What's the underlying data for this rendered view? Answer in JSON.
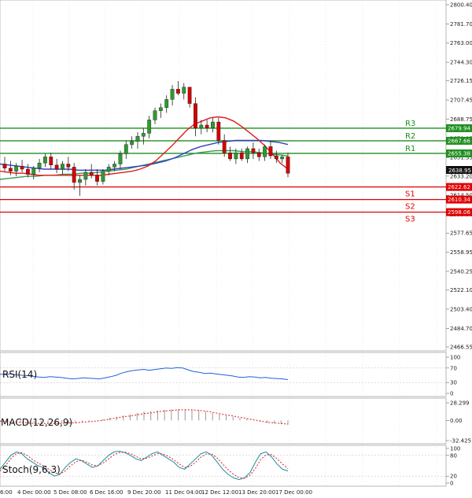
{
  "chart_data": {
    "type": "candlestick",
    "price_axis": {
      "ticks": [
        "2800.40",
        "2781.70",
        "2763.00",
        "2744.30",
        "2726.15",
        "2707.45",
        "2688.75",
        "2670.05",
        "2651.35",
        "2633.20",
        "2614.50",
        "2595.80",
        "2577.65",
        "2558.95",
        "2540.25",
        "2522.10",
        "2503.40",
        "2484.70",
        "2466.55"
      ],
      "ylim": [
        2466.55,
        2800.4
      ]
    },
    "current_price": "2638.95",
    "levels": [
      {
        "name": "R3",
        "value": "2679.94",
        "color": "#1f8f1f"
      },
      {
        "name": "R2",
        "value": "2667.66",
        "color": "#1f8f1f"
      },
      {
        "name": "R1",
        "value": "2655.38",
        "color": "#1f8f1f"
      },
      {
        "name": "S1",
        "value": "2622.62",
        "color": "#e00000"
      },
      {
        "name": "S2",
        "value": "2610.34",
        "color": "#e00000"
      },
      {
        "name": "S3",
        "value": "2598.06",
        "color": "#e00000"
      }
    ],
    "candles_ohlc": [
      [
        2645,
        2652,
        2638,
        2641
      ],
      [
        2641,
        2648,
        2634,
        2638
      ],
      [
        2638,
        2646,
        2633,
        2643
      ],
      [
        2643,
        2649,
        2637,
        2640
      ],
      [
        2640,
        2645,
        2632,
        2635
      ],
      [
        2635,
        2643,
        2630,
        2641
      ],
      [
        2641,
        2650,
        2637,
        2646
      ],
      [
        2646,
        2655,
        2642,
        2652
      ],
      [
        2652,
        2656,
        2640,
        2644
      ],
      [
        2644,
        2650,
        2636,
        2640
      ],
      [
        2640,
        2648,
        2635,
        2645
      ],
      [
        2645,
        2652,
        2638,
        2642
      ],
      [
        2642,
        2646,
        2620,
        2627
      ],
      [
        2627,
        2634,
        2614,
        2630
      ],
      [
        2630,
        2640,
        2624,
        2637
      ],
      [
        2637,
        2645,
        2631,
        2634
      ],
      [
        2634,
        2640,
        2624,
        2628
      ],
      [
        2628,
        2640,
        2625,
        2638
      ],
      [
        2638,
        2645,
        2634,
        2642
      ],
      [
        2642,
        2648,
        2638,
        2645
      ],
      [
        2645,
        2658,
        2640,
        2655
      ],
      [
        2655,
        2668,
        2650,
        2664
      ],
      [
        2664,
        2672,
        2660,
        2667
      ],
      [
        2667,
        2676,
        2660,
        2672
      ],
      [
        2672,
        2680,
        2664,
        2675
      ],
      [
        2675,
        2692,
        2670,
        2688
      ],
      [
        2688,
        2700,
        2684,
        2697
      ],
      [
        2697,
        2704,
        2690,
        2700
      ],
      [
        2700,
        2712,
        2695,
        2708
      ],
      [
        2708,
        2722,
        2702,
        2718
      ],
      [
        2718,
        2726,
        2712,
        2714
      ],
      [
        2714,
        2724,
        2708,
        2720
      ],
      [
        2720,
        2716,
        2700,
        2704
      ],
      [
        2704,
        2710,
        2672,
        2680
      ],
      [
        2680,
        2688,
        2674,
        2683
      ],
      [
        2683,
        2688,
        2676,
        2680
      ],
      [
        2680,
        2690,
        2676,
        2686
      ],
      [
        2686,
        2690,
        2664,
        2668
      ],
      [
        2668,
        2674,
        2652,
        2656
      ],
      [
        2656,
        2662,
        2648,
        2650
      ],
      [
        2650,
        2660,
        2645,
        2656
      ],
      [
        2656,
        2660,
        2648,
        2650
      ],
      [
        2650,
        2662,
        2646,
        2660
      ],
      [
        2660,
        2666,
        2650,
        2656
      ],
      [
        2656,
        2660,
        2648,
        2652
      ],
      [
        2652,
        2664,
        2648,
        2662
      ],
      [
        2662,
        2668,
        2650,
        2653
      ],
      [
        2653,
        2658,
        2646,
        2650
      ],
      [
        2650,
        2654,
        2646,
        2652
      ],
      [
        2652,
        2656,
        2632,
        2636
      ]
    ],
    "ema_red": [
      2638,
      2637,
      2636,
      2636,
      2635,
      2634,
      2634,
      2634,
      2634,
      2634,
      2634,
      2634,
      2634,
      2634,
      2635,
      2636,
      2637,
      2638,
      2640,
      2643,
      2648,
      2655,
      2662,
      2670,
      2678,
      2684,
      2687,
      2690,
      2691,
      2690,
      2687,
      2682,
      2676,
      2670,
      2663,
      2655,
      2646,
      2640
    ],
    "ema_blue": [
      2645,
      2644,
      2643,
      2642,
      2641,
      2640,
      2640,
      2640,
      2640,
      2639,
      2639,
      2639,
      2639,
      2640,
      2641,
      2642,
      2643,
      2644,
      2646,
      2648,
      2651,
      2655,
      2659,
      2662,
      2664,
      2666,
      2667,
      2668,
      2668,
      2668,
      2668,
      2667,
      2666,
      2664
    ],
    "ema_green": [
      2630,
      2631,
      2632,
      2633,
      2633,
      2634,
      2634,
      2635,
      2635,
      2636,
      2636,
      2637,
      2638,
      2639,
      2640,
      2642,
      2644,
      2646,
      2648,
      2650,
      2652,
      2654,
      2656,
      2657,
      2658,
      2658,
      2658,
      2657,
      2657,
      2656,
      2655,
      2654,
      2653
    ],
    "x_ticks": [
      "6:00",
      "4 Dec 00:00",
      "5 Dec 08:00",
      "6 Dec 16:00",
      "9 Dec 20:00",
      "11 Dec 04:00",
      "12 Dec 12:00",
      "13 Dec 20:00",
      "17 Dec 00:00"
    ],
    "rsi": {
      "label": "RSI(14)",
      "ticks": [
        "100",
        "70",
        "30",
        "0"
      ],
      "values": [
        53,
        52,
        54,
        51,
        50,
        49,
        47,
        45,
        44,
        46,
        45,
        44,
        42,
        40,
        41,
        43,
        42,
        41,
        40,
        43,
        46,
        50,
        56,
        60,
        63,
        65,
        66,
        64,
        66,
        68,
        70,
        69,
        71,
        70,
        65,
        60,
        58,
        55,
        56,
        54,
        52,
        50,
        48,
        45,
        44,
        46,
        45,
        43,
        44,
        42,
        41,
        40,
        38
      ]
    },
    "macd": {
      "label": "MACD(12,26,9)",
      "ticks": [
        "28.299",
        "0.00",
        "-32.425"
      ],
      "histogram": [
        -2,
        -3,
        -4,
        -4,
        -5,
        -5,
        -6,
        -6,
        -5,
        -5,
        -5,
        -4,
        -3,
        -2,
        0,
        2,
        4,
        6,
        8,
        10,
        12,
        14,
        15,
        16,
        17,
        18,
        18,
        18,
        17,
        16,
        14,
        12,
        10,
        8,
        6,
        4,
        2,
        0,
        -2,
        -4,
        -5,
        -6,
        -7
      ],
      "signal": [
        -1,
        -2,
        -3,
        -3,
        -4,
        -5,
        -5,
        -5,
        -5,
        -5,
        -4,
        -4,
        -3,
        -2,
        -1,
        0,
        2,
        4,
        6,
        7,
        9,
        11,
        12,
        14,
        15,
        16,
        17,
        17,
        17,
        16,
        15,
        13,
        11,
        9,
        7,
        5,
        3,
        1,
        -1,
        -3,
        -4,
        -5,
        -6
      ]
    },
    "stoch": {
      "label": "Stoch(9,6,3)",
      "ticks": [
        "100",
        "80",
        "20",
        "0"
      ],
      "k": [
        40,
        60,
        80,
        90,
        85,
        70,
        60,
        50,
        45,
        30,
        20,
        25,
        45,
        60,
        70,
        65,
        55,
        45,
        50,
        65,
        80,
        90,
        92,
        88,
        80,
        70,
        65,
        75,
        85,
        90,
        80,
        70,
        60,
        45,
        40,
        55,
        70,
        85,
        90,
        80,
        60,
        40,
        25,
        15,
        10,
        15,
        30,
        60,
        85,
        90,
        75,
        55,
        40,
        35
      ],
      "d": [
        35,
        50,
        70,
        85,
        88,
        80,
        68,
        58,
        50,
        40,
        30,
        26,
        35,
        50,
        62,
        66,
        60,
        52,
        50,
        58,
        70,
        82,
        88,
        89,
        85,
        77,
        70,
        72,
        78,
        85,
        84,
        77,
        67,
        55,
        45,
        48,
        60,
        75,
        84,
        84,
        72,
        55,
        38,
        25,
        16,
        14,
        22,
        42,
        68,
        82,
        82,
        70,
        55,
        42
      ]
    }
  }
}
